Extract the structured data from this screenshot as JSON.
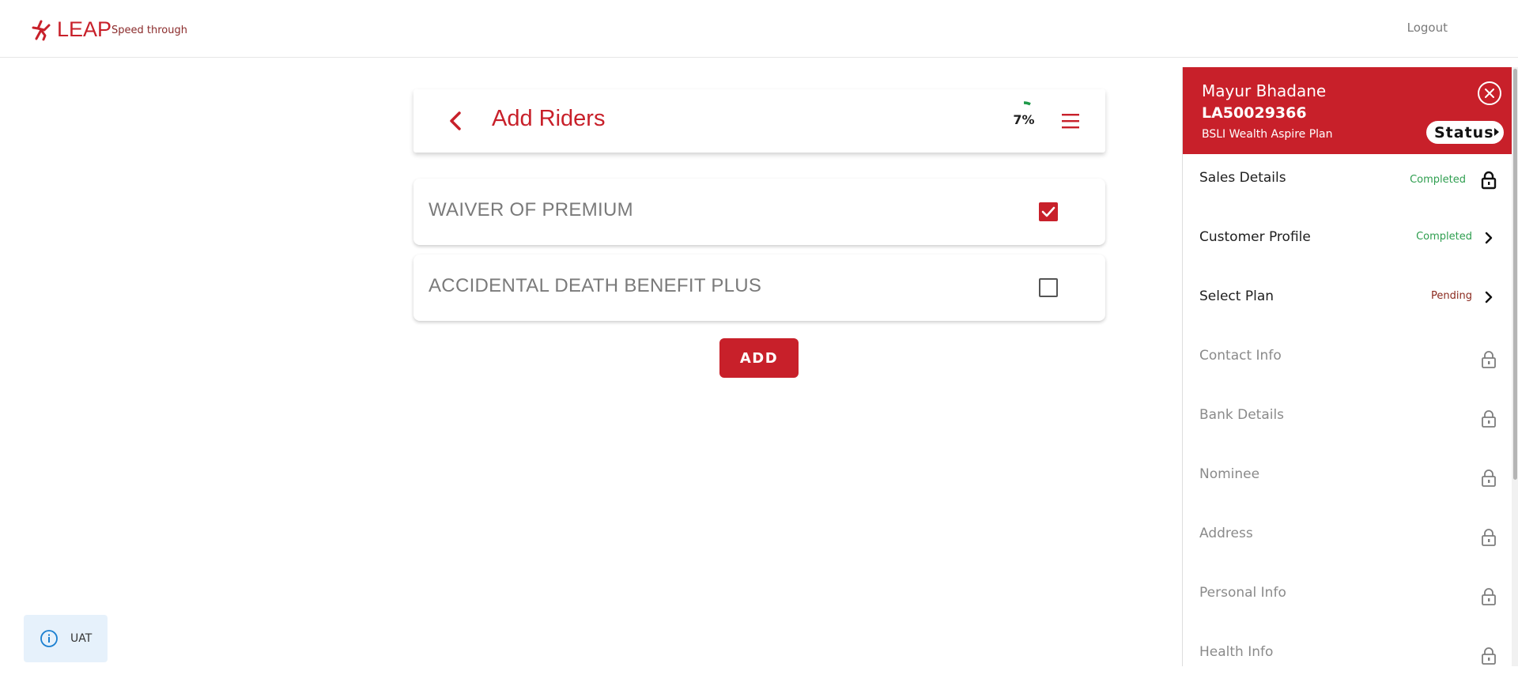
{
  "header": {
    "logo_text": "LEAP",
    "tagline": "Speed through",
    "logout_label": "Logout"
  },
  "main": {
    "title": "Add Riders",
    "progress_text": "7%",
    "progress_fraction": 0.07,
    "riders": [
      {
        "label": "WAIVER OF PREMIUM",
        "checked": true
      },
      {
        "label": "ACCIDENTAL DEATH BENEFIT PLUS",
        "checked": false
      }
    ],
    "add_label": "ADD"
  },
  "env_badge": {
    "label": "UAT",
    "icon": "info-icon"
  },
  "panel": {
    "customer_name": "Mayur Bhadane",
    "application_id": "LA50029366",
    "plan_name": "BSLI Wealth Aspire Plan",
    "status_label": "Status",
    "steps": [
      {
        "label": "Sales Details",
        "status": "Completed",
        "icon": "lock-open-icon",
        "active": true
      },
      {
        "label": "Customer Profile",
        "status": "Completed",
        "icon": "chevron-right-icon",
        "active": true
      },
      {
        "label": "Select Plan",
        "status": "Pending",
        "icon": "chevron-right-icon",
        "active": true
      },
      {
        "label": "Contact Info",
        "status": "",
        "icon": "lock-icon",
        "active": false
      },
      {
        "label": "Bank Details",
        "status": "",
        "icon": "lock-icon",
        "active": false
      },
      {
        "label": "Nominee",
        "status": "",
        "icon": "lock-icon",
        "active": false
      },
      {
        "label": "Address",
        "status": "",
        "icon": "lock-icon",
        "active": false
      },
      {
        "label": "Personal Info",
        "status": "",
        "icon": "lock-icon",
        "active": false
      },
      {
        "label": "Health Info",
        "status": "",
        "icon": "lock-icon",
        "active": false
      }
    ]
  },
  "colors": {
    "brand": "#c8202a",
    "completed": "#2e9e4f",
    "pending": "#8b2a1f",
    "progress": "#1f9a4a"
  }
}
